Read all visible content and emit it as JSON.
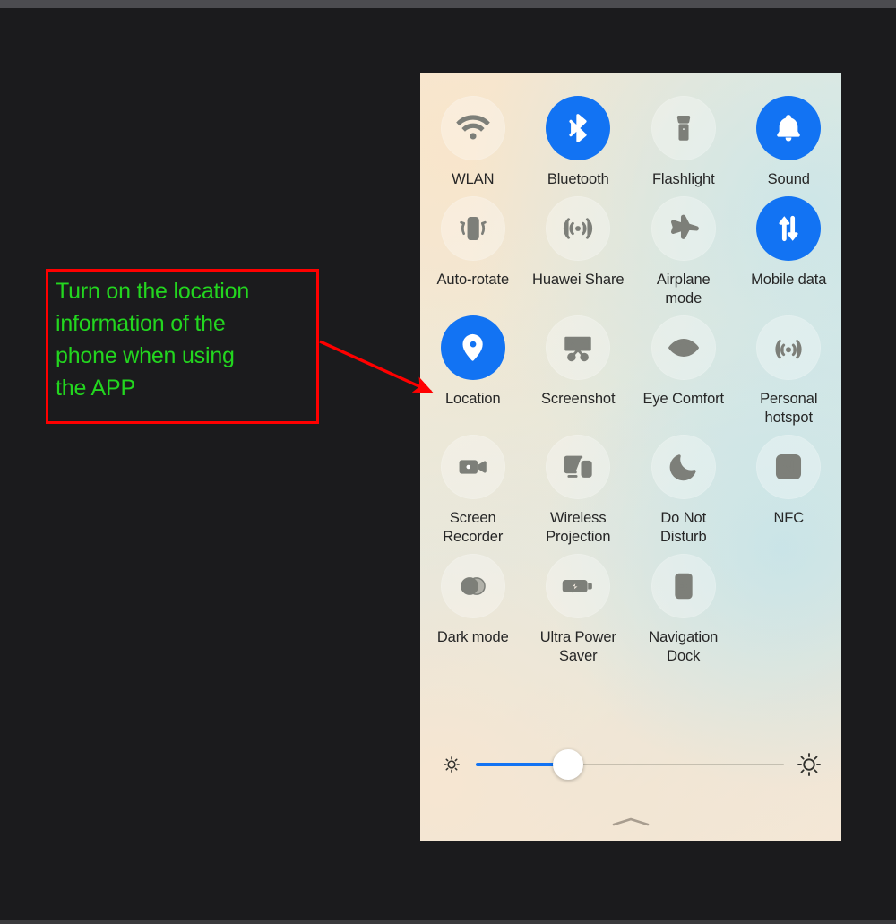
{
  "annotation": {
    "text": "Turn on the location\ninformation of the\nphone when using\nthe APP",
    "box_color": "#ff0000",
    "text_color": "#23d61f",
    "arrow_color": "#ff0000",
    "arrow_target": "Location"
  },
  "panel": {
    "background_start": "#f6e9d7",
    "background_end": "#d8e8e6",
    "accent_on_color": "#1273f3",
    "label_color": "#262626",
    "tiles": [
      {
        "label": "WLAN",
        "icon": "wifi-icon",
        "state": "off"
      },
      {
        "label": "Bluetooth",
        "icon": "bluetooth-icon",
        "state": "on"
      },
      {
        "label": "Flashlight",
        "icon": "flashlight-icon",
        "state": "off"
      },
      {
        "label": "Sound",
        "icon": "bell-icon",
        "state": "on"
      },
      {
        "label": "Auto-rotate",
        "icon": "auto-rotate-icon",
        "state": "off"
      },
      {
        "label": "Huawei Share",
        "icon": "huawei-share-icon",
        "state": "off"
      },
      {
        "label": "Airplane\nmode",
        "icon": "airplane-icon",
        "state": "off"
      },
      {
        "label": "Mobile data",
        "icon": "mobile-data-icon",
        "state": "on"
      },
      {
        "label": "Location",
        "icon": "location-pin-icon",
        "state": "on"
      },
      {
        "label": "Screenshot",
        "icon": "screenshot-icon",
        "state": "off"
      },
      {
        "label": "Eye Comfort",
        "icon": "eye-icon",
        "state": "off"
      },
      {
        "label": "Personal\nhotspot",
        "icon": "hotspot-icon",
        "state": "off"
      },
      {
        "label": "Screen\nRecorder",
        "icon": "video-camera-icon",
        "state": "off"
      },
      {
        "label": "Wireless\nProjection",
        "icon": "wireless-projection-icon",
        "state": "off"
      },
      {
        "label": "Do Not\nDisturb",
        "icon": "moon-icon",
        "state": "off"
      },
      {
        "label": "NFC",
        "icon": "nfc-icon",
        "state": "off"
      },
      {
        "label": "Dark mode",
        "icon": "dark-mode-icon",
        "state": "off"
      },
      {
        "label": "Ultra Power\nSaver",
        "icon": "battery-charging-icon",
        "state": "off"
      },
      {
        "label": "Navigation\nDock",
        "icon": "navigation-dock-icon",
        "state": "off"
      }
    ],
    "brightness": {
      "icon_low": "sun-small-icon",
      "icon_high": "sun-large-icon",
      "value_percent": 30,
      "fill_color": "#1273f3"
    },
    "expand_handle_icon": "chevron-up-icon"
  }
}
